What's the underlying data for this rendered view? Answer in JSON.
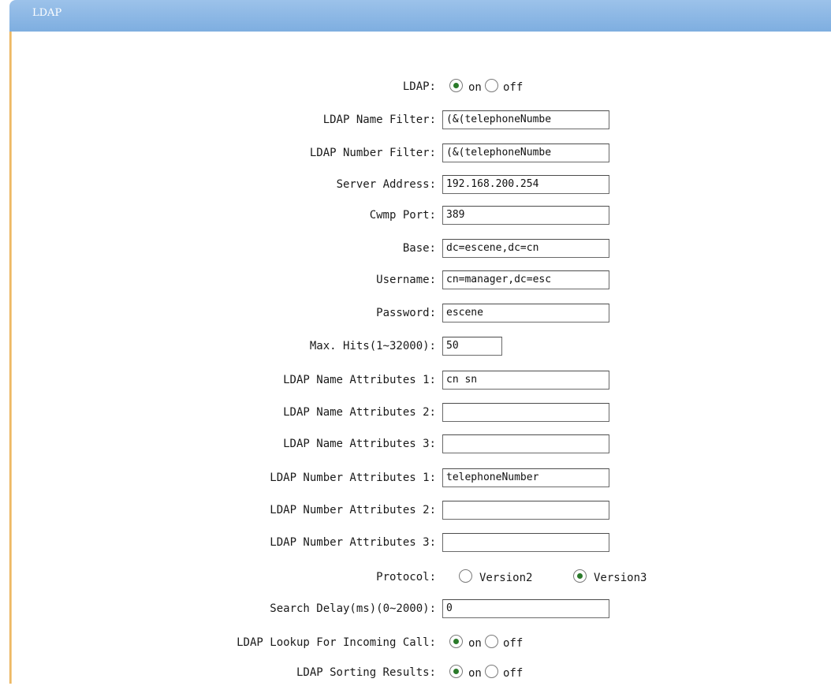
{
  "panel": {
    "title": "LDAP"
  },
  "form": {
    "ldap": {
      "label": "LDAP:",
      "options": [
        "on",
        "off"
      ],
      "selected": "on"
    },
    "name_filter": {
      "label": "LDAP Name Filter:",
      "value": "(&(telephoneNumbe"
    },
    "number_filter": {
      "label": "LDAP Number Filter:",
      "value": "(&(telephoneNumbe"
    },
    "server_address": {
      "label": "Server Address:",
      "value": "192.168.200.254"
    },
    "cwmp_port": {
      "label": "Cwmp Port:",
      "value": "389"
    },
    "base": {
      "label": "Base:",
      "value": "dc=escene,dc=cn"
    },
    "username": {
      "label": "Username:",
      "value": "cn=manager,dc=esc"
    },
    "password": {
      "label": "Password:",
      "value": "escene"
    },
    "max_hits": {
      "label": "Max. Hits(1~32000):",
      "value": "50"
    },
    "name_attr1": {
      "label": "LDAP Name Attributes 1:",
      "value": "cn sn"
    },
    "name_attr2": {
      "label": "LDAP Name Attributes 2:",
      "value": ""
    },
    "name_attr3": {
      "label": "LDAP Name Attributes 3:",
      "value": ""
    },
    "number_attr1": {
      "label": "LDAP Number Attributes 1:",
      "value": "telephoneNumber"
    },
    "number_attr2": {
      "label": "LDAP Number Attributes 2:",
      "value": ""
    },
    "number_attr3": {
      "label": "LDAP Number Attributes 3:",
      "value": ""
    },
    "protocol": {
      "label": "Protocol:",
      "options": [
        "Version2",
        "Version3"
      ],
      "selected": "Version3"
    },
    "search_delay": {
      "label": "Search Delay(ms)(0~2000):",
      "value": "0"
    },
    "lookup_incoming": {
      "label": "LDAP Lookup For Incoming Call:",
      "options": [
        "on",
        "off"
      ],
      "selected": "on"
    },
    "sorting_results": {
      "label": "LDAP Sorting Results:",
      "options": [
        "on",
        "off"
      ],
      "selected": "on"
    }
  },
  "colors": {
    "header": "#8bb6e4",
    "accent_border": "#e8a640",
    "radio_dot": "#2a7a2a"
  }
}
